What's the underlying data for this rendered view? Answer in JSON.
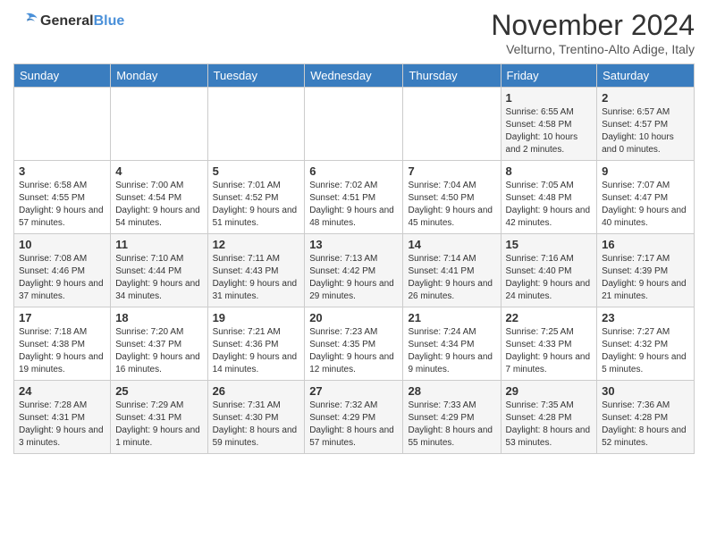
{
  "header": {
    "logo_text_general": "General",
    "logo_text_blue": "Blue",
    "month_title": "November 2024",
    "location": "Velturno, Trentino-Alto Adige, Italy"
  },
  "days_of_week": [
    "Sunday",
    "Monday",
    "Tuesday",
    "Wednesday",
    "Thursday",
    "Friday",
    "Saturday"
  ],
  "weeks": [
    [
      {
        "day": "",
        "info": ""
      },
      {
        "day": "",
        "info": ""
      },
      {
        "day": "",
        "info": ""
      },
      {
        "day": "",
        "info": ""
      },
      {
        "day": "",
        "info": ""
      },
      {
        "day": "1",
        "info": "Sunrise: 6:55 AM\nSunset: 4:58 PM\nDaylight: 10 hours and 2 minutes."
      },
      {
        "day": "2",
        "info": "Sunrise: 6:57 AM\nSunset: 4:57 PM\nDaylight: 10 hours and 0 minutes."
      }
    ],
    [
      {
        "day": "3",
        "info": "Sunrise: 6:58 AM\nSunset: 4:55 PM\nDaylight: 9 hours and 57 minutes."
      },
      {
        "day": "4",
        "info": "Sunrise: 7:00 AM\nSunset: 4:54 PM\nDaylight: 9 hours and 54 minutes."
      },
      {
        "day": "5",
        "info": "Sunrise: 7:01 AM\nSunset: 4:52 PM\nDaylight: 9 hours and 51 minutes."
      },
      {
        "day": "6",
        "info": "Sunrise: 7:02 AM\nSunset: 4:51 PM\nDaylight: 9 hours and 48 minutes."
      },
      {
        "day": "7",
        "info": "Sunrise: 7:04 AM\nSunset: 4:50 PM\nDaylight: 9 hours and 45 minutes."
      },
      {
        "day": "8",
        "info": "Sunrise: 7:05 AM\nSunset: 4:48 PM\nDaylight: 9 hours and 42 minutes."
      },
      {
        "day": "9",
        "info": "Sunrise: 7:07 AM\nSunset: 4:47 PM\nDaylight: 9 hours and 40 minutes."
      }
    ],
    [
      {
        "day": "10",
        "info": "Sunrise: 7:08 AM\nSunset: 4:46 PM\nDaylight: 9 hours and 37 minutes."
      },
      {
        "day": "11",
        "info": "Sunrise: 7:10 AM\nSunset: 4:44 PM\nDaylight: 9 hours and 34 minutes."
      },
      {
        "day": "12",
        "info": "Sunrise: 7:11 AM\nSunset: 4:43 PM\nDaylight: 9 hours and 31 minutes."
      },
      {
        "day": "13",
        "info": "Sunrise: 7:13 AM\nSunset: 4:42 PM\nDaylight: 9 hours and 29 minutes."
      },
      {
        "day": "14",
        "info": "Sunrise: 7:14 AM\nSunset: 4:41 PM\nDaylight: 9 hours and 26 minutes."
      },
      {
        "day": "15",
        "info": "Sunrise: 7:16 AM\nSunset: 4:40 PM\nDaylight: 9 hours and 24 minutes."
      },
      {
        "day": "16",
        "info": "Sunrise: 7:17 AM\nSunset: 4:39 PM\nDaylight: 9 hours and 21 minutes."
      }
    ],
    [
      {
        "day": "17",
        "info": "Sunrise: 7:18 AM\nSunset: 4:38 PM\nDaylight: 9 hours and 19 minutes."
      },
      {
        "day": "18",
        "info": "Sunrise: 7:20 AM\nSunset: 4:37 PM\nDaylight: 9 hours and 16 minutes."
      },
      {
        "day": "19",
        "info": "Sunrise: 7:21 AM\nSunset: 4:36 PM\nDaylight: 9 hours and 14 minutes."
      },
      {
        "day": "20",
        "info": "Sunrise: 7:23 AM\nSunset: 4:35 PM\nDaylight: 9 hours and 12 minutes."
      },
      {
        "day": "21",
        "info": "Sunrise: 7:24 AM\nSunset: 4:34 PM\nDaylight: 9 hours and 9 minutes."
      },
      {
        "day": "22",
        "info": "Sunrise: 7:25 AM\nSunset: 4:33 PM\nDaylight: 9 hours and 7 minutes."
      },
      {
        "day": "23",
        "info": "Sunrise: 7:27 AM\nSunset: 4:32 PM\nDaylight: 9 hours and 5 minutes."
      }
    ],
    [
      {
        "day": "24",
        "info": "Sunrise: 7:28 AM\nSunset: 4:31 PM\nDaylight: 9 hours and 3 minutes."
      },
      {
        "day": "25",
        "info": "Sunrise: 7:29 AM\nSunset: 4:31 PM\nDaylight: 9 hours and 1 minute."
      },
      {
        "day": "26",
        "info": "Sunrise: 7:31 AM\nSunset: 4:30 PM\nDaylight: 8 hours and 59 minutes."
      },
      {
        "day": "27",
        "info": "Sunrise: 7:32 AM\nSunset: 4:29 PM\nDaylight: 8 hours and 57 minutes."
      },
      {
        "day": "28",
        "info": "Sunrise: 7:33 AM\nSunset: 4:29 PM\nDaylight: 8 hours and 55 minutes."
      },
      {
        "day": "29",
        "info": "Sunrise: 7:35 AM\nSunset: 4:28 PM\nDaylight: 8 hours and 53 minutes."
      },
      {
        "day": "30",
        "info": "Sunrise: 7:36 AM\nSunset: 4:28 PM\nDaylight: 8 hours and 52 minutes."
      }
    ]
  ]
}
